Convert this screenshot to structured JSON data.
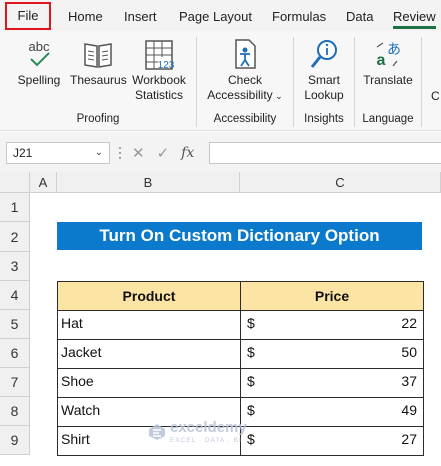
{
  "tabs": [
    {
      "label": "File"
    },
    {
      "label": "Home"
    },
    {
      "label": "Insert"
    },
    {
      "label": "Page Layout"
    },
    {
      "label": "Formulas"
    },
    {
      "label": "Data"
    },
    {
      "label": "Review"
    }
  ],
  "ribbon": {
    "proofing": {
      "label": "Proofing",
      "spelling": "Spelling",
      "spelling_icon_text": "abc",
      "thesaurus": "Thesaurus",
      "workbook_stats_line1": "Workbook",
      "workbook_stats_line2": "Statistics",
      "stats_icon_text": "123"
    },
    "accessibility": {
      "label": "Accessibility",
      "check_line1": "Check",
      "check_line2": "Accessibility"
    },
    "insights": {
      "label": "Insights",
      "smart_line1": "Smart",
      "smart_line2": "Lookup"
    },
    "language": {
      "label": "Language",
      "translate": "Translate"
    },
    "cut_off_letter": "C"
  },
  "formula_bar": {
    "name_box": "J21",
    "formula": ""
  },
  "sheet": {
    "columns": [
      "A",
      "B",
      "C"
    ],
    "rows": [
      "1",
      "2",
      "3",
      "4",
      "5",
      "6",
      "7",
      "8",
      "9"
    ],
    "title": "Turn On Custom Dictionary Option",
    "headers": [
      "Product",
      "Price"
    ],
    "data": [
      {
        "product": "Hat",
        "currency": "$",
        "price": "22"
      },
      {
        "product": "Jacket",
        "currency": "$",
        "price": "50"
      },
      {
        "product": "Shoe",
        "currency": "$",
        "price": "37"
      },
      {
        "product": "Watch",
        "currency": "$",
        "price": "49"
      },
      {
        "product": "Shirt",
        "currency": "$",
        "price": "27"
      }
    ]
  },
  "watermark": {
    "name": "exceldemy",
    "tagline": "EXCEL · DATA · BI"
  },
  "colors": {
    "accent": "#1e7145",
    "title_fill": "#0b79cc",
    "header_fill": "#fce4a4",
    "file_highlight": "#e0151b"
  }
}
